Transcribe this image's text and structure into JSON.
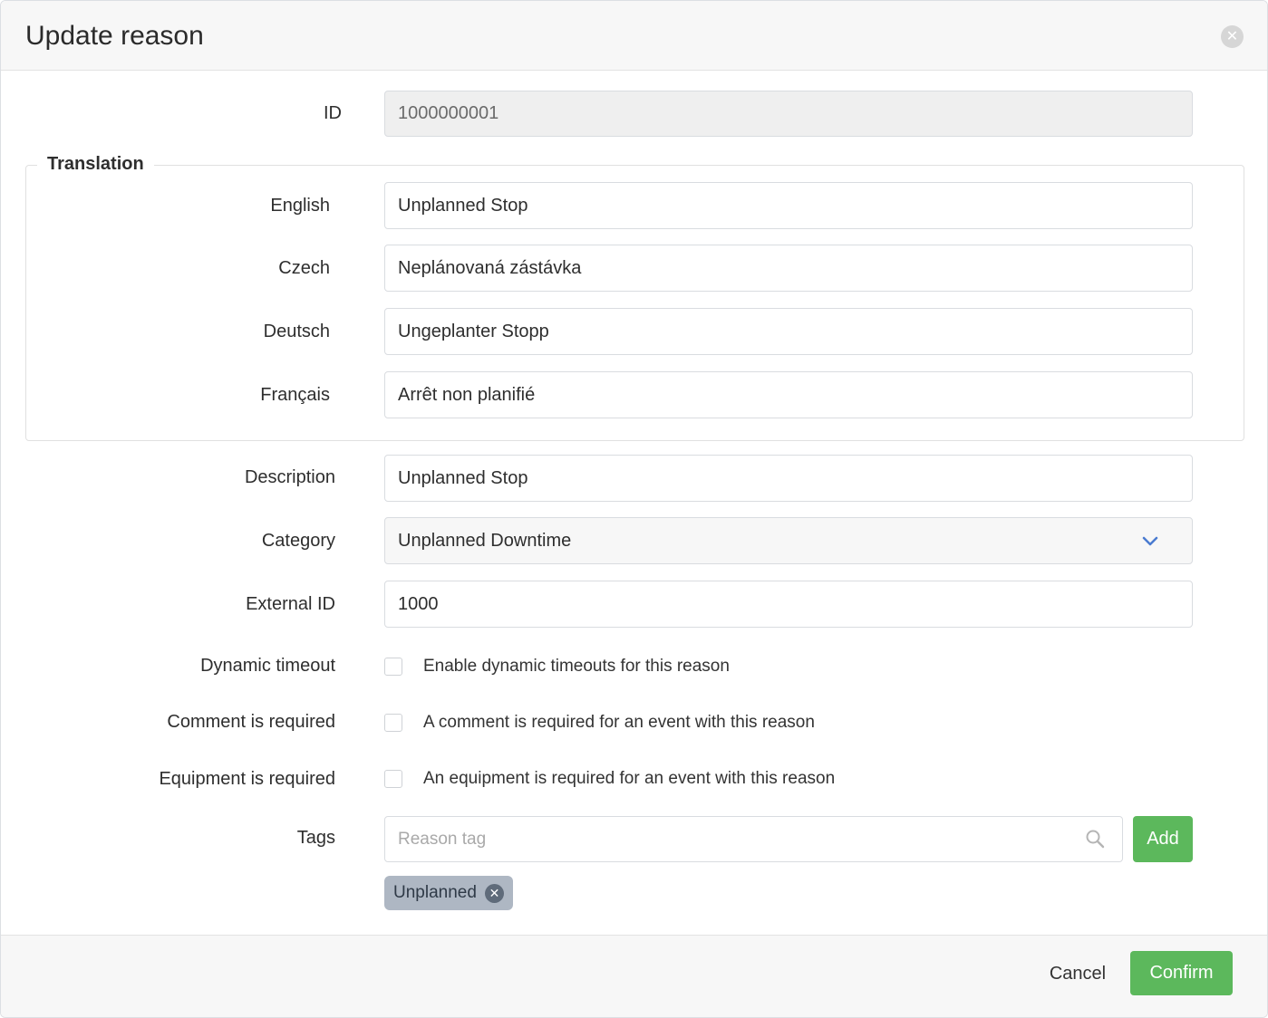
{
  "modal": {
    "title": "Update reason",
    "close_icon": "close-icon"
  },
  "form": {
    "id": {
      "label": "ID",
      "value": "1000000001"
    },
    "translation": {
      "legend": "Translation",
      "english": {
        "label": "English",
        "value": "Unplanned Stop"
      },
      "czech": {
        "label": "Czech",
        "value": "Neplánovaná zástávka"
      },
      "deutsch": {
        "label": "Deutsch",
        "value": "Ungeplanter Stopp"
      },
      "francais": {
        "label": "Français",
        "value": "Arrêt non planifié"
      }
    },
    "description": {
      "label": "Description",
      "value": "Unplanned Stop"
    },
    "category": {
      "label": "Category",
      "value": "Unplanned Downtime"
    },
    "external_id": {
      "label": "External ID",
      "value": "1000"
    },
    "dynamic_timeout": {
      "label": "Dynamic timeout",
      "text": "Enable dynamic timeouts for this reason",
      "checked": false
    },
    "comment_required": {
      "label": "Comment is required",
      "text": "A comment is required for an event with this reason",
      "checked": false
    },
    "equipment_required": {
      "label": "Equipment is required",
      "text": "An equipment is required for an event with this reason",
      "checked": false
    },
    "tags": {
      "label": "Tags",
      "placeholder": "Reason tag",
      "add_label": "Add",
      "items": [
        "Unplanned"
      ]
    }
  },
  "footer": {
    "cancel_label": "Cancel",
    "confirm_label": "Confirm"
  },
  "colors": {
    "accent_green": "#5cb85c",
    "chevron_blue": "#4a7bd0",
    "tag_chip": "#aeb7c3"
  }
}
